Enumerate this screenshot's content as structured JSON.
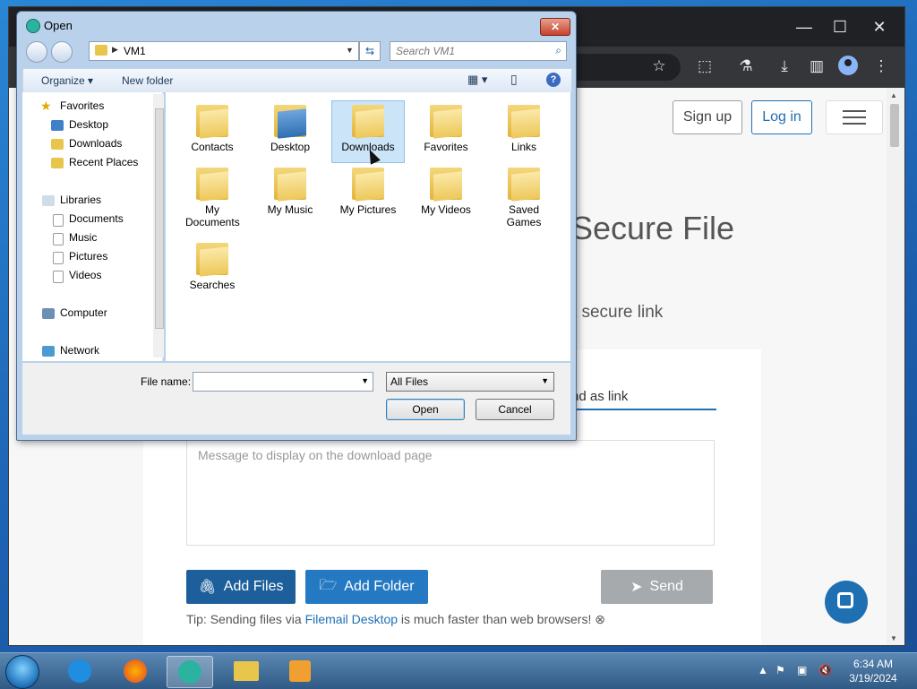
{
  "dialog": {
    "title": "Open",
    "address": "VM1",
    "search_placeholder": "Search VM1",
    "organize_label": "Organize ▾",
    "new_folder_label": "New folder",
    "close_glyph": "✕",
    "nav": {
      "favorites": "Favorites",
      "desktop": "Desktop",
      "downloads": "Downloads",
      "recent": "Recent Places",
      "libraries": "Libraries",
      "documents": "Documents",
      "music": "Music",
      "pictures": "Pictures",
      "videos": "Videos",
      "computer": "Computer",
      "network": "Network"
    },
    "folders": [
      "Contacts",
      "Desktop",
      "Downloads",
      "Favorites",
      "Links",
      "My Documents",
      "My Music",
      "My Pictures",
      "My Videos",
      "Saved Games",
      "Searches"
    ],
    "file_name_label": "File name:",
    "file_name_value": "",
    "filter_value": "All Files",
    "open_label": "Open",
    "cancel_label": "Cancel"
  },
  "browser": {
    "signup_label": "Sign up",
    "login_label": "Log in",
    "hero_title": "Secure File",
    "hero_sub": "r a secure link",
    "tab_send_link": "nd as link",
    "message_placeholder": "Message to display on the download page",
    "add_files_label": "Add Files",
    "add_folder_label": "Add Folder",
    "send_label": "Send",
    "tip_prefix": "Tip: Sending files via ",
    "tip_link": "Filemail Desktop",
    "tip_suffix": " is much faster than web browsers!",
    "window_controls": {
      "minimize": "—",
      "maximize": "☐",
      "close": "✕"
    }
  },
  "taskbar": {
    "time": "6:34 AM",
    "date": "3/19/2024"
  },
  "colors": {
    "accent": "#1f6fb3",
    "send_disabled": "#a7aaad",
    "desktop": "#1e73c4"
  }
}
